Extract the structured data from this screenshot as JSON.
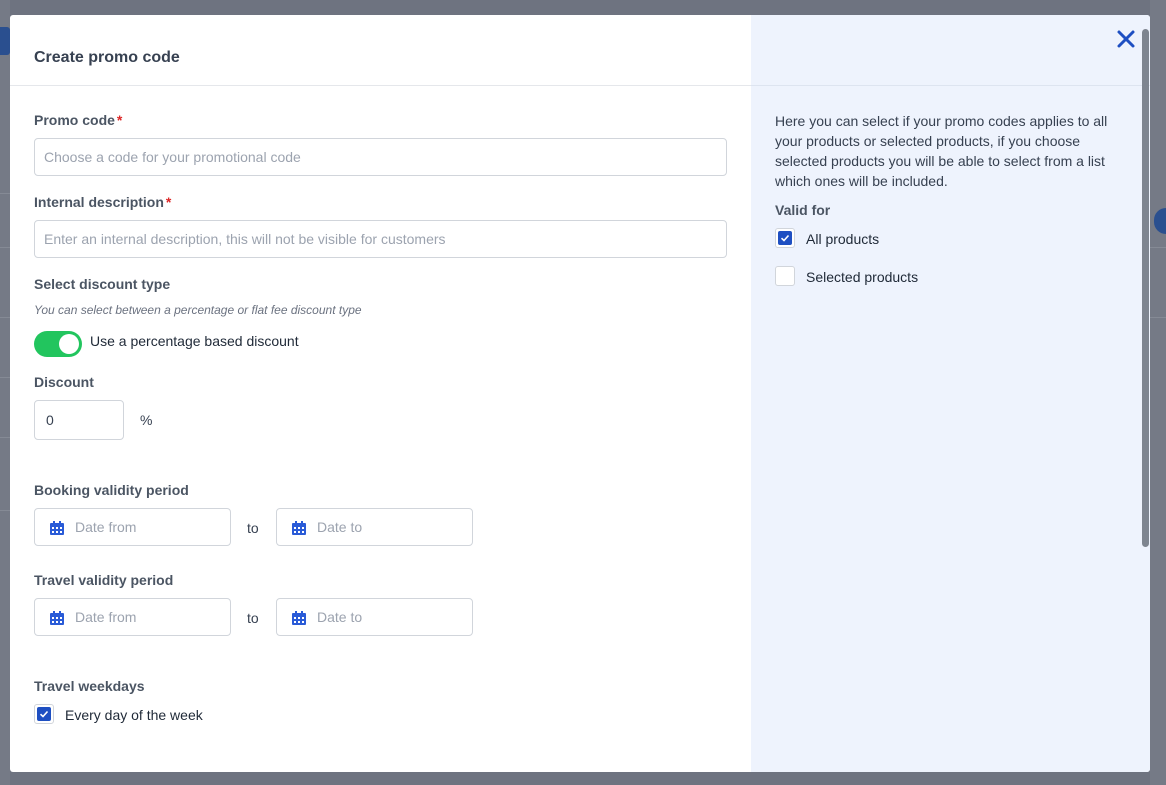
{
  "modal": {
    "title": "Create promo code",
    "close_icon": "close-icon"
  },
  "promo_code": {
    "label": "Promo code",
    "required_mark": "*",
    "placeholder": "Choose a code for your promotional code"
  },
  "internal_description": {
    "label": "Internal description",
    "required_mark": "*",
    "placeholder": "Enter an internal description, this will not be visible for customers"
  },
  "discount_type": {
    "label": "Select discount type",
    "hint": "You can select between a percentage or flat fee discount type",
    "toggle_label": "Use a percentage based discount",
    "toggle_on": true,
    "toggle_color": "#22c55e"
  },
  "discount": {
    "label": "Discount",
    "value": "0",
    "unit": "%"
  },
  "booking_validity": {
    "label": "Booking validity period",
    "from_placeholder": "Date from",
    "to_text": "to",
    "to_placeholder": "Date to"
  },
  "travel_validity": {
    "label": "Travel validity period",
    "from_placeholder": "Date from",
    "to_text": "to",
    "to_placeholder": "Date to"
  },
  "travel_weekdays": {
    "label": "Travel weekdays",
    "option_label": "Every day of the week",
    "checked": true
  },
  "sidebar": {
    "help_text": "Here you can select if your promo codes applies to all your products or selected products, if you choose selected products you will be able to select from a list which ones will be included.",
    "valid_for_label": "Valid for",
    "options": [
      {
        "label": "All products",
        "checked": true
      },
      {
        "label": "Selected products",
        "checked": false
      }
    ]
  },
  "colors": {
    "accent": "#1e4fc2",
    "required": "#dc2626",
    "sidebar_bg": "#eef3fd"
  }
}
